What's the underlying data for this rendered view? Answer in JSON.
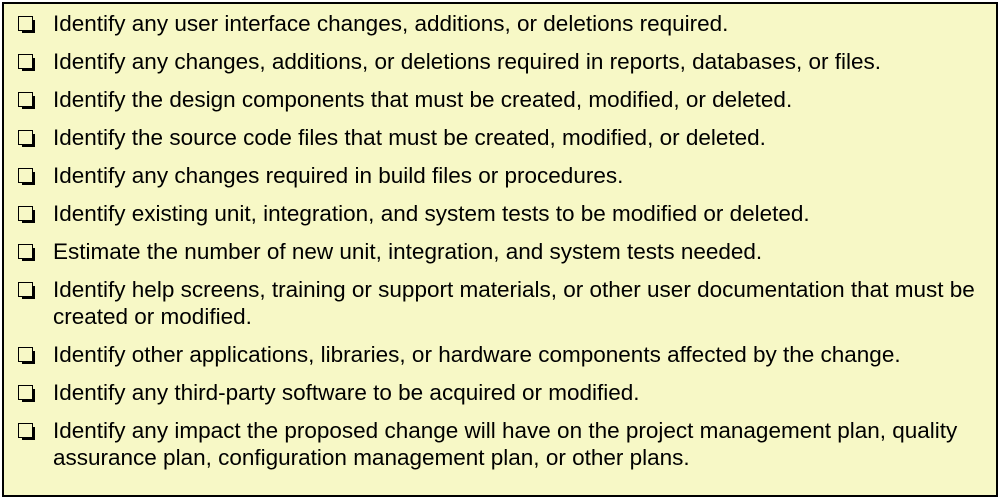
{
  "checklist": {
    "items": [
      "Identify any user interface changes, additions, or deletions required.",
      "Identify any changes, additions, or deletions required in reports, databases, or files.",
      "Identify the design components that must be created, modified, or deleted.",
      "Identify the source code files that must be created, modified, or deleted.",
      "Identify any changes required in build files or procedures.",
      "Identify existing unit, integration, and system tests to be modified or deleted.",
      "Estimate the number of new unit, integration, and system tests needed.",
      "Identify help screens, training or support materials, or other user documentation that must be created or modified.",
      "Identify other applications, libraries, or hardware components affected by the change.",
      "Identify any third-party software to be acquired or modified.",
      "Identify any impact the proposed change will have on the project management plan, quality assurance plan, configuration management plan, or other plans."
    ]
  },
  "colors": {
    "panel_background": "#f7f8c6",
    "border": "#000000",
    "text": "#000000"
  },
  "icons": {
    "bullet": "checkbox-icon"
  }
}
